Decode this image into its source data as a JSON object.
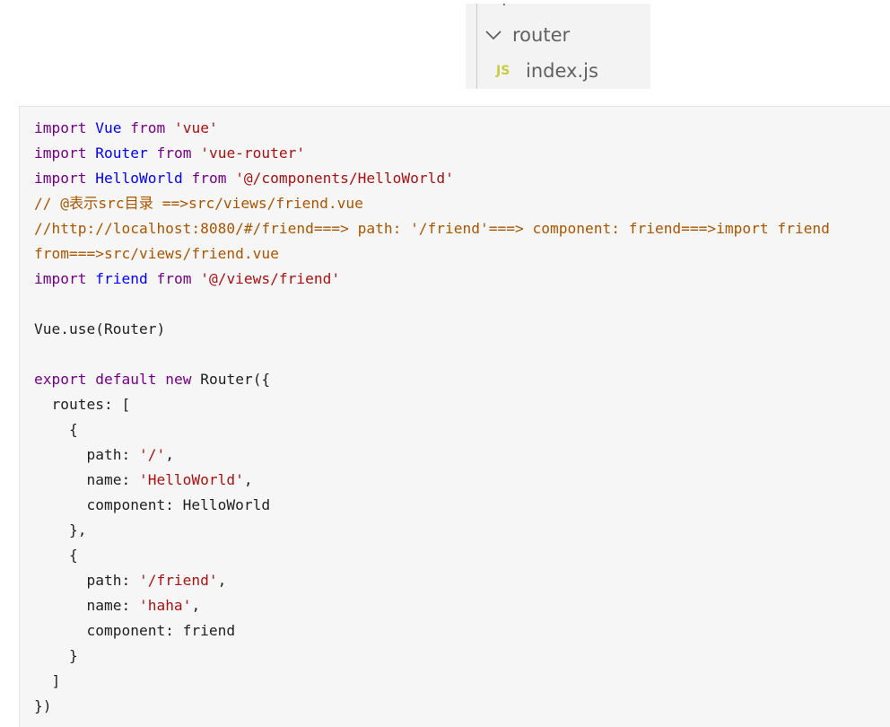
{
  "explorer": {
    "folder": {
      "name": "router",
      "expanded": true
    },
    "file": {
      "icon": "JS",
      "name": "index.js"
    },
    "colors": {
      "background": "#f3f3f3",
      "text": "#616161",
      "js_icon": "#cbcb41"
    }
  },
  "code": {
    "language": "javascript",
    "colors": {
      "background": "#f6f6f6",
      "keyword": "#770088",
      "identifier": "#0000ff",
      "string": "#aa1111",
      "comment": "#aa5500",
      "plain": "#1f1f1f"
    },
    "lines": [
      [
        {
          "t": "import",
          "c": "kw"
        },
        {
          "t": " ",
          "c": "pun"
        },
        {
          "t": "Vue",
          "c": "def"
        },
        {
          "t": " ",
          "c": "pun"
        },
        {
          "t": "from",
          "c": "kw"
        },
        {
          "t": " ",
          "c": "pun"
        },
        {
          "t": "'vue'",
          "c": "str"
        }
      ],
      [
        {
          "t": "import",
          "c": "kw"
        },
        {
          "t": " ",
          "c": "pun"
        },
        {
          "t": "Router",
          "c": "def"
        },
        {
          "t": " ",
          "c": "pun"
        },
        {
          "t": "from",
          "c": "kw"
        },
        {
          "t": " ",
          "c": "pun"
        },
        {
          "t": "'vue-router'",
          "c": "str"
        }
      ],
      [
        {
          "t": "import",
          "c": "kw"
        },
        {
          "t": " ",
          "c": "pun"
        },
        {
          "t": "HelloWorld",
          "c": "def"
        },
        {
          "t": " ",
          "c": "pun"
        },
        {
          "t": "from",
          "c": "kw"
        },
        {
          "t": " ",
          "c": "pun"
        },
        {
          "t": "'@/components/HelloWorld'",
          "c": "str"
        }
      ],
      [
        {
          "t": "// @表示src目录 ==>src/views/friend.vue",
          "c": "com"
        }
      ],
      [
        {
          "t": "//http://localhost:8080/#/friend===> path: '/friend'===> component: friend===>import friend",
          "c": "com"
        }
      ],
      [
        {
          "t": "from===>src/views/friend.vue",
          "c": "com"
        }
      ],
      [
        {
          "t": "import",
          "c": "kw"
        },
        {
          "t": " ",
          "c": "pun"
        },
        {
          "t": "friend",
          "c": "def"
        },
        {
          "t": " ",
          "c": "pun"
        },
        {
          "t": "from",
          "c": "kw"
        },
        {
          "t": " ",
          "c": "pun"
        },
        {
          "t": "'@/views/friend'",
          "c": "str"
        }
      ],
      [],
      [
        {
          "t": "Vue.use(Router)",
          "c": "pun"
        }
      ],
      [],
      [
        {
          "t": "export",
          "c": "kw"
        },
        {
          "t": " ",
          "c": "pun"
        },
        {
          "t": "default",
          "c": "kw"
        },
        {
          "t": " ",
          "c": "pun"
        },
        {
          "t": "new",
          "c": "kw"
        },
        {
          "t": " Router({",
          "c": "pun"
        }
      ],
      [
        {
          "t": "  routes: [",
          "c": "pun"
        }
      ],
      [
        {
          "t": "    {",
          "c": "pun"
        }
      ],
      [
        {
          "t": "      path: ",
          "c": "pun"
        },
        {
          "t": "'/'",
          "c": "str"
        },
        {
          "t": ",",
          "c": "pun"
        }
      ],
      [
        {
          "t": "      name: ",
          "c": "pun"
        },
        {
          "t": "'HelloWorld'",
          "c": "str"
        },
        {
          "t": ",",
          "c": "pun"
        }
      ],
      [
        {
          "t": "      component: HelloWorld",
          "c": "pun"
        }
      ],
      [
        {
          "t": "    },",
          "c": "pun"
        }
      ],
      [
        {
          "t": "    {",
          "c": "pun"
        }
      ],
      [
        {
          "t": "      path: ",
          "c": "pun"
        },
        {
          "t": "'/friend'",
          "c": "str"
        },
        {
          "t": ",",
          "c": "pun"
        }
      ],
      [
        {
          "t": "      name: ",
          "c": "pun"
        },
        {
          "t": "'haha'",
          "c": "str"
        },
        {
          "t": ",",
          "c": "pun"
        }
      ],
      [
        {
          "t": "      component: friend",
          "c": "pun"
        }
      ],
      [
        {
          "t": "    }",
          "c": "pun"
        }
      ],
      [
        {
          "t": "  ]",
          "c": "pun"
        }
      ],
      [
        {
          "t": "})",
          "c": "pun"
        }
      ]
    ]
  }
}
